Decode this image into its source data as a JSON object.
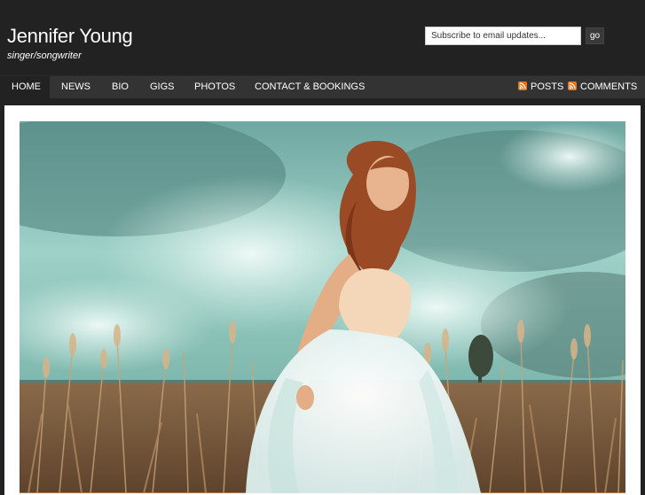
{
  "code_glyph": "< />",
  "header": {
    "title": "Jennifer Young",
    "tagline": "singer/songwriter"
  },
  "subscribe": {
    "placeholder": "Subscribe to email updates...",
    "button_label": "go"
  },
  "nav": {
    "items": [
      {
        "label": "HOME",
        "active": true
      },
      {
        "label": "NEWS"
      },
      {
        "label": "BIO"
      },
      {
        "label": "GIGS"
      },
      {
        "label": "PHOTOS"
      },
      {
        "label": "CONTACT & BOOKINGS"
      }
    ],
    "feeds": [
      {
        "label": "POSTS",
        "icon": "rss-icon"
      },
      {
        "label": "COMMENTS",
        "icon": "rss-icon"
      }
    ]
  },
  "colors": {
    "background": "#222222",
    "nav_bar": "#333333",
    "rss": "#e8731c",
    "content": "#ffffff"
  }
}
